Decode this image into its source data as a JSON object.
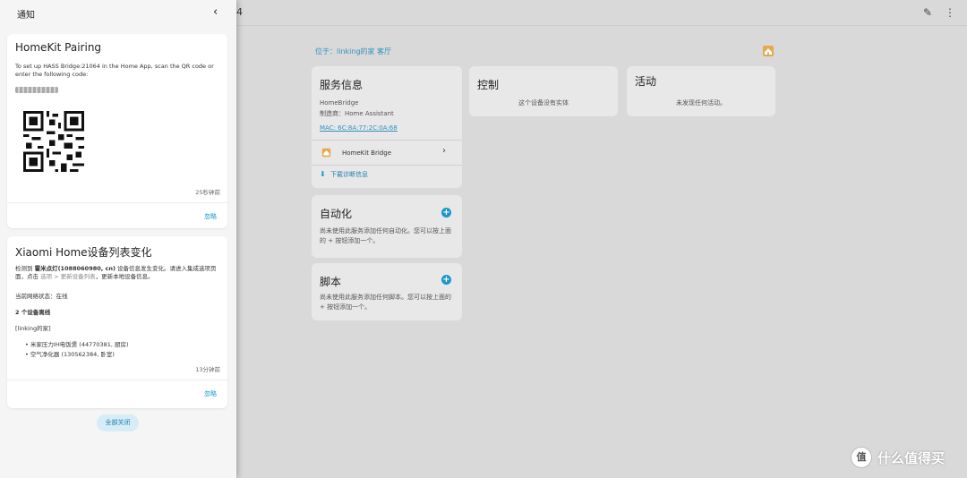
{
  "app": {
    "title_suffix": "4",
    "breadcrumb": "位于：linking的家 客厅"
  },
  "cards": {
    "service": {
      "title": "服务信息",
      "model": "HomeBridge",
      "manufacturer": "制造商：Home Assistant",
      "mac": "MAC: 6C:8A:77:2C:0A:68",
      "entry_label": "HomeKit Bridge",
      "download": "下载诊断信息"
    },
    "control": {
      "title": "控制",
      "empty": "这个设备没有实体"
    },
    "activity": {
      "title": "活动",
      "empty": "未发现任何活动。"
    },
    "automation": {
      "title": "自动化",
      "text": "尚未使用此服务添加任何自动化。您可以按上面的 + 按钮添加一个。"
    },
    "script": {
      "title": "脚本",
      "text": "尚未使用此服务添加任何脚本。您可以按上面的 + 按钮添加一个。"
    }
  },
  "drawer": {
    "title": "通知",
    "notifications": [
      {
        "title": "HomeKit Pairing",
        "text": "To set up HASS Bridge:21064 in the Home App, scan the QR code or enter the following code:",
        "time": "25秒钟前",
        "dismiss": "忽略"
      },
      {
        "title": "Xiaomi Home设备列表变化",
        "text1_a": "检测到 ",
        "text1_b": "霍米点灯(1088060980, cn)",
        "text1_c": " 设备信息发生变化。请进入集成选项页面，点击 ",
        "text1_d": "选项 > 更新设备列表",
        "text1_e": "，更新本地设备信息。",
        "network": "当前网络状态：在线",
        "offline_count": "2 个设备离线",
        "home": "[linking的家]",
        "devices": [
          "米家压力IH电饭煲 (44770381, 厨房)",
          "空气净化器 (130562384, 卧室)"
        ],
        "time": "13分钟前",
        "dismiss": "忽略"
      }
    ],
    "dismiss_all": "全部关闭"
  },
  "watermark": {
    "badge": "值",
    "text": "什么值得买"
  },
  "colors": {
    "accent": "#1a96c9",
    "drawer_bg": "#f5f5f5",
    "scrim": "#d9d9d9"
  }
}
